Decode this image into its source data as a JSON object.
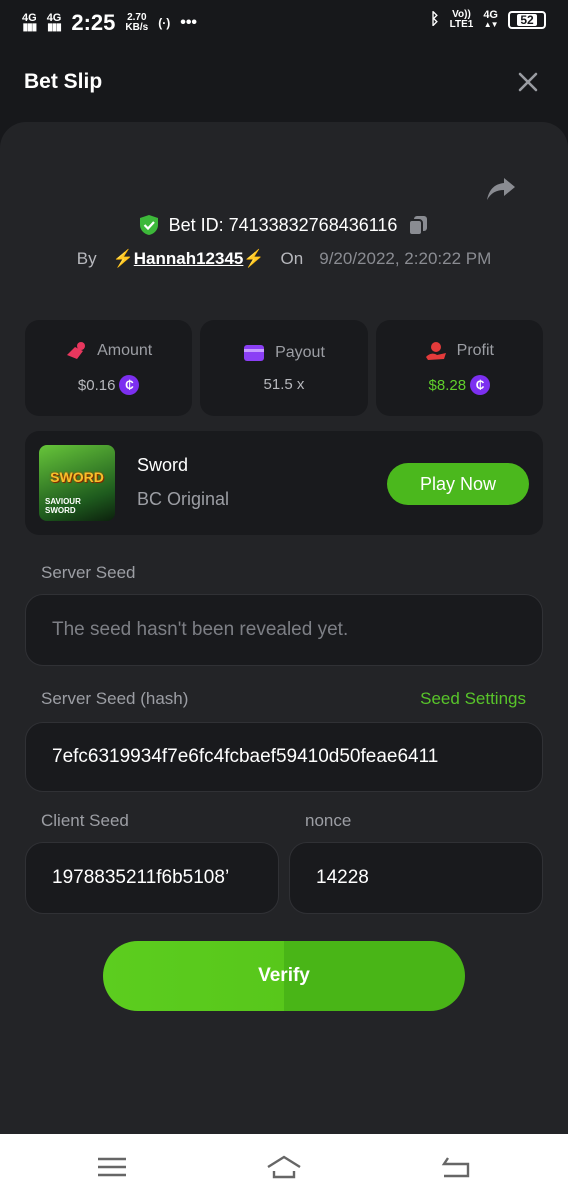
{
  "status_bar": {
    "sim1": "4G",
    "sim2": "4G",
    "time": "2:25",
    "speed_value": "2.70",
    "speed_unit": "KB/s",
    "volte": "Vo))",
    "lte": "LTE1",
    "net": "4G",
    "battery": "52"
  },
  "header": {
    "title": "Bet Slip",
    "close_icon": "close-icon"
  },
  "bet": {
    "id_label": "Bet ID: 74133832768436116",
    "by_label": "By",
    "username": "Hannah12345",
    "on_label": "On",
    "date": "9/20/2022, 2:20:22 PM"
  },
  "stats": {
    "amount_label": "Amount",
    "amount_value": "$0.16",
    "payout_label": "Payout",
    "payout_value": "51.5 x",
    "profit_label": "Profit",
    "profit_value": "$8.28",
    "coin_symbol": "₵"
  },
  "game": {
    "thumb_title": "SWORD",
    "thumb_sub": "SAVIOUR SWORD",
    "name": "Sword",
    "provider": "BC Original",
    "play_label": "Play Now"
  },
  "seeds": {
    "server_seed_label": "Server Seed",
    "server_seed_placeholder": "The seed hasn't been revealed yet.",
    "server_hash_label": "Server Seed (hash)",
    "seed_settings_label": "Seed Settings",
    "server_hash_value": "7efc6319934f7e6fc4fcbaef59410d50feae6411",
    "client_seed_label": "Client Seed",
    "client_seed_value": "1978835211f6b5108’",
    "nonce_label": "nonce",
    "nonce_value": "14228"
  },
  "verify_label": "Verify",
  "colors": {
    "accent_green": "#58c42a",
    "background": "#17181b",
    "panel": "#232427",
    "coin_purple": "#7c2ff0"
  }
}
